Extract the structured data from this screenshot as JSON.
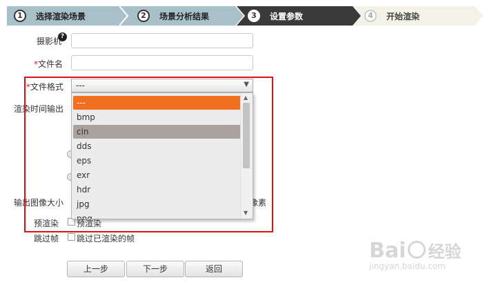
{
  "steps": [
    {
      "num": "1",
      "label": "选择渲染场景"
    },
    {
      "num": "2",
      "label": "场景分析结果"
    },
    {
      "num": "3",
      "label": "设置参数"
    },
    {
      "num": "4",
      "label": "开始渲染"
    }
  ],
  "form": {
    "camera_label": "摄影机",
    "help_glyph": "?",
    "filename_label": "文件名",
    "required_mark": "*",
    "format_label": "文件格式",
    "format_value": "---",
    "format_arrow": "▼",
    "time_output_label": "渲染时间输出",
    "image_size_label": "输出图像大小",
    "pixels_suffix": "像素",
    "prerender_label": "预渲染",
    "prerender_check_label": "预渲染",
    "skip_frames_label": "跳过帧",
    "skip_frames_check_label": "跳过已渲染的帧"
  },
  "dropdown": {
    "options": [
      "---",
      "bmp",
      "cin",
      "dds",
      "eps",
      "exr",
      "hdr",
      "jpg",
      "png"
    ],
    "selected": "---",
    "highlighted": "cin",
    "scroll_up": "▲",
    "scroll_down": "▼"
  },
  "buttons": {
    "prev": "上一步",
    "next": "下一步",
    "back": "返回"
  },
  "watermark": {
    "brand": "Bai",
    "brand_suffix": "经验",
    "url": "jingyan.baidu.com"
  },
  "colors": {
    "step_done": "#a8c1c9",
    "step_active": "#3a3a3a",
    "step_todo": "#f2f2e6",
    "dropdown_selected": "#f07020",
    "annotation_box": "#e01010"
  }
}
